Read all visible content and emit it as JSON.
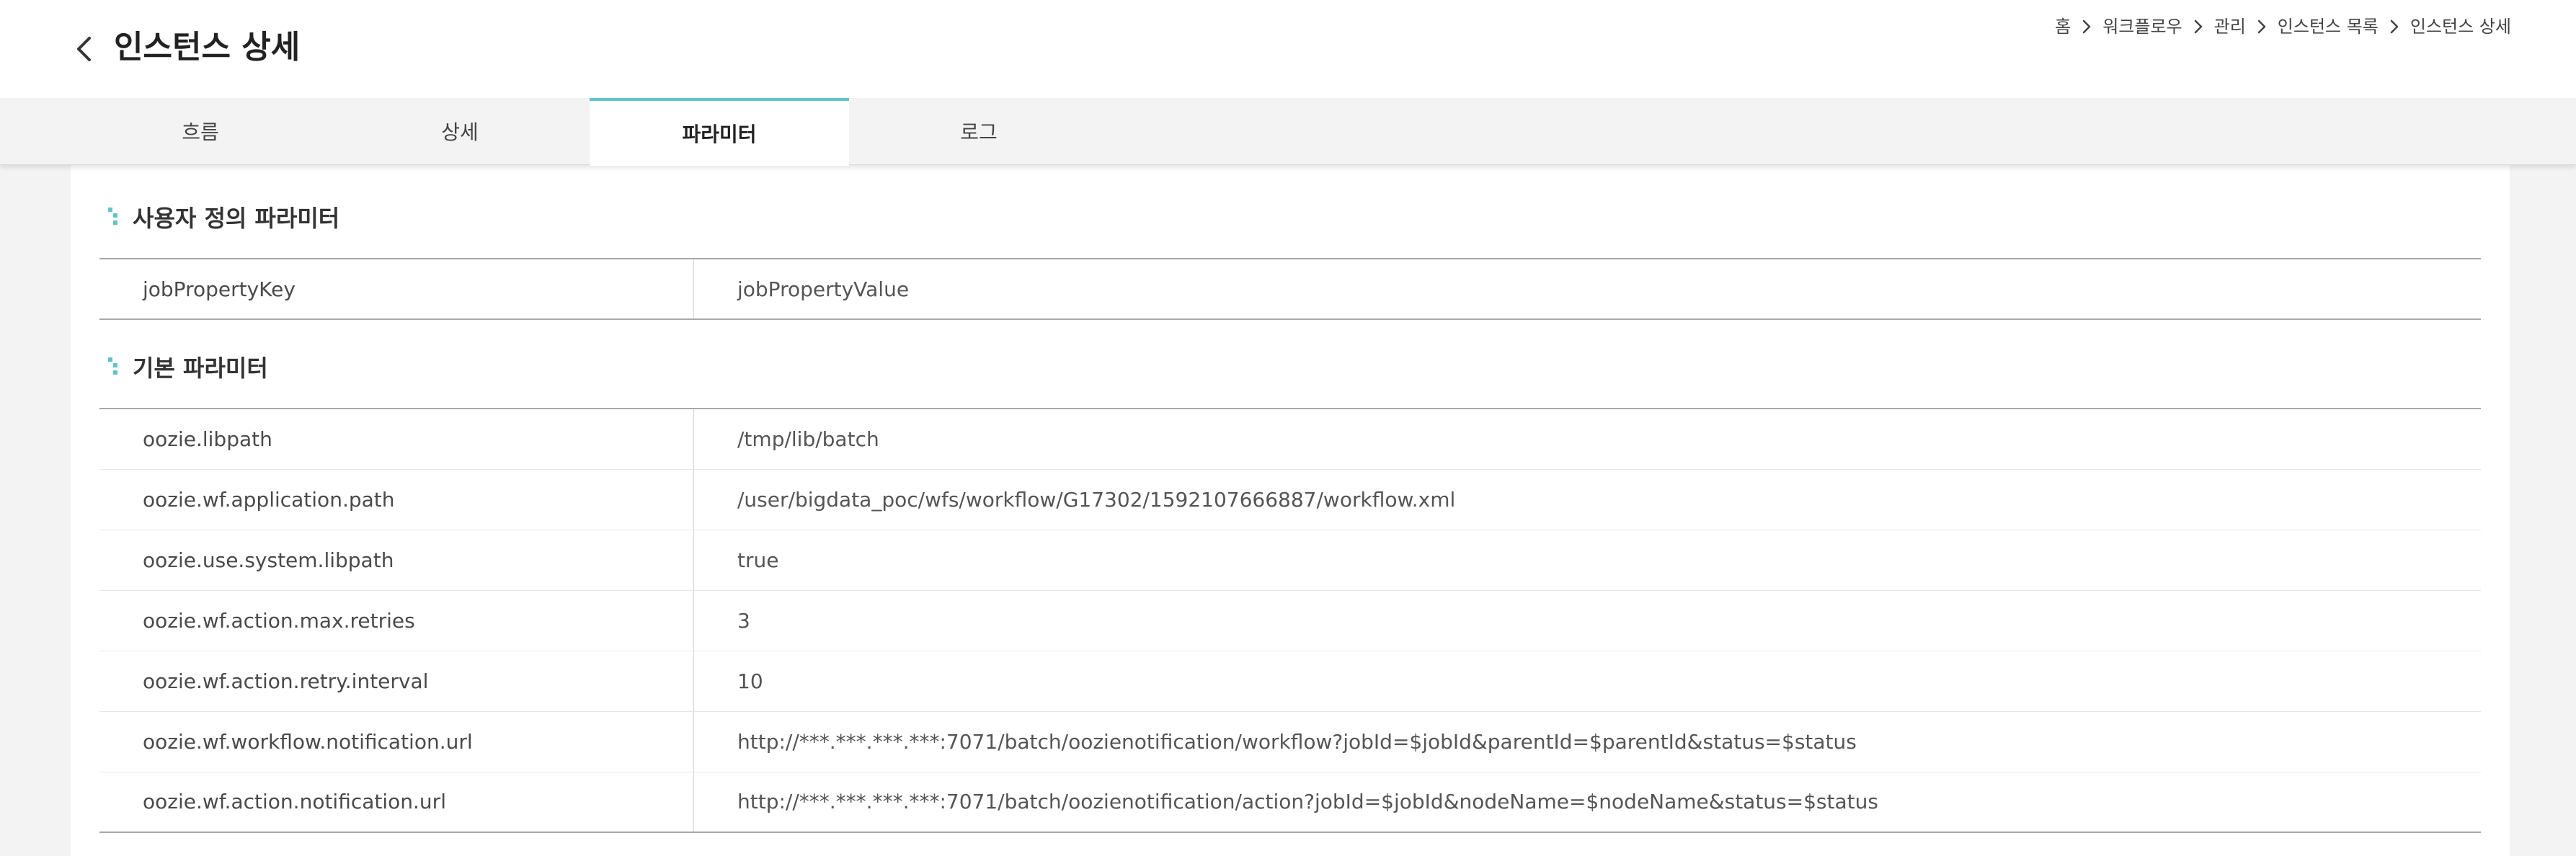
{
  "header": {
    "title": "인스턴스 상세",
    "breadcrumb": [
      "홈",
      "워크플로우",
      "관리",
      "인스턴스 목록",
      "인스턴스 상세"
    ]
  },
  "tabs": [
    {
      "label": "흐름",
      "active": false
    },
    {
      "label": "상세",
      "active": false
    },
    {
      "label": "파라미터",
      "active": true
    },
    {
      "label": "로그",
      "active": false
    }
  ],
  "user_params": {
    "title": "사용자 정의 파라미터",
    "rows": [
      {
        "key": "jobPropertyKey",
        "value": "jobPropertyValue"
      }
    ]
  },
  "basic_params": {
    "title": "기본 파라미터",
    "rows": [
      {
        "key": "oozie.libpath",
        "value": "/tmp/lib/batch"
      },
      {
        "key": "oozie.wf.application.path",
        "value": "/user/bigdata_poc/wfs/workflow/G17302/1592107666887/workflow.xml"
      },
      {
        "key": "oozie.use.system.libpath",
        "value": "true"
      },
      {
        "key": "oozie.wf.action.max.retries",
        "value": "3"
      },
      {
        "key": "oozie.wf.action.retry.interval",
        "value": "10"
      },
      {
        "key": "oozie.wf.workflow.notification.url",
        "value": "http://***.***.***.***:7071/batch/oozienotification/workflow?jobId=$jobId&parentId=$parentId&status=$status"
      },
      {
        "key": "oozie.wf.action.notification.url",
        "value": "http://***.***.***.***:7071/batch/oozienotification/action?jobId=$jobId&nodeName=$nodeName&status=$status"
      }
    ]
  },
  "colors": {
    "accent": "#63c3c9",
    "background": "#f3f3f3"
  },
  "icons": {
    "back": "chevron-left-icon",
    "breadcrumb_separator": "chevron-right-icon",
    "section": "section-bullet-icon"
  }
}
